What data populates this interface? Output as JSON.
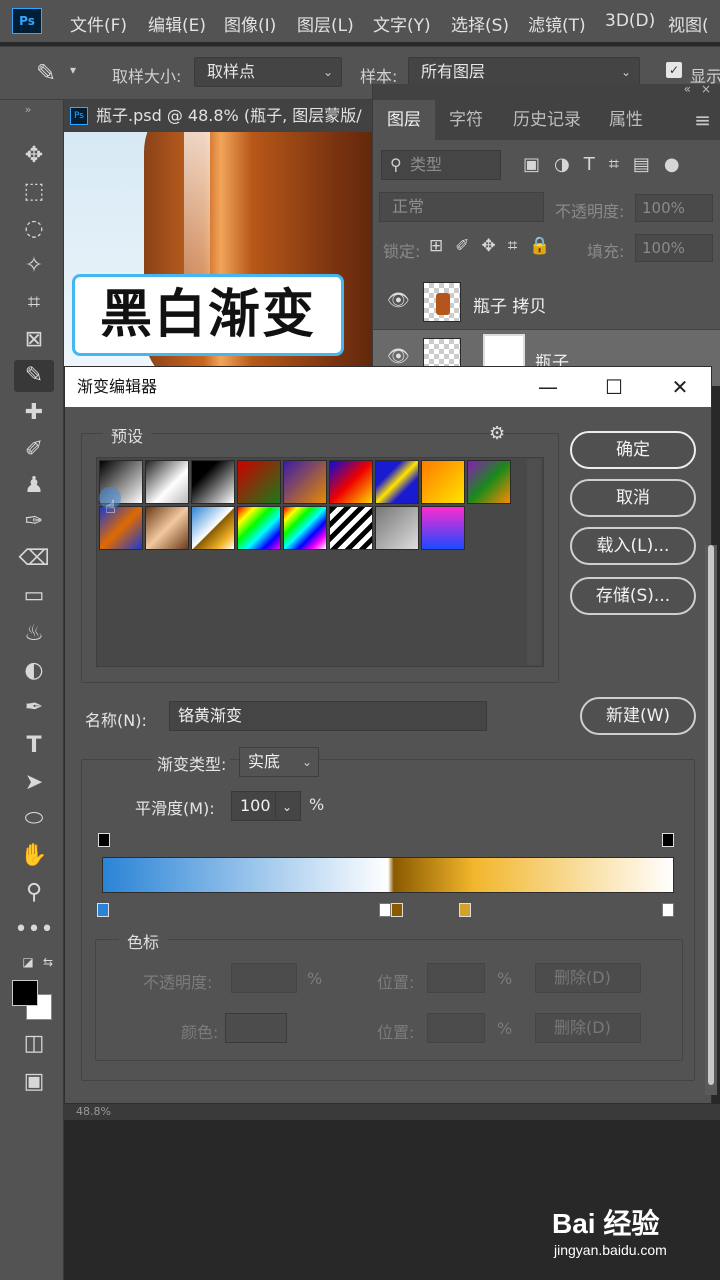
{
  "app": {
    "logo": "Ps",
    "menu": [
      "文件(F)",
      "编辑(E)",
      "图像(I)",
      "图层(L)",
      "文字(Y)",
      "选择(S)",
      "滤镜(T)",
      "3D(D)",
      "视图("
    ]
  },
  "options": {
    "sample_size_label": "取样大小:",
    "sample_size_value": "取样点",
    "sample_label": "样本:",
    "sample_value": "所有图层",
    "show_label": "显示"
  },
  "document": {
    "tab_title": "瓶子.psd @ 48.8% (瓶子, 图层蒙版/",
    "canvas_label": "黑白渐变",
    "status": "48.8%"
  },
  "layers_panel": {
    "tabs": [
      "图层",
      "字符",
      "历史记录",
      "属性"
    ],
    "filter_placeholder": "类型",
    "blend_mode": "正常",
    "opacity_label": "不透明度:",
    "opacity_value": "100%",
    "lock_label": "锁定:",
    "fill_label": "填充:",
    "fill_value": "100%",
    "layers": [
      {
        "name": "瓶子 拷贝"
      },
      {
        "name": "瓶子"
      }
    ]
  },
  "dialog": {
    "title": "渐变编辑器",
    "presets_label": "预设",
    "buttons": {
      "ok": "确定",
      "cancel": "取消",
      "load": "载入(L)...",
      "save": "存储(S)...",
      "new": "新建(W)"
    },
    "name_label": "名称(N):",
    "name_value": "铬黄渐变",
    "type_label": "渐变类型:",
    "type_value": "实底",
    "smooth_label": "平滑度(M):",
    "smooth_value": "100",
    "smooth_unit": "%",
    "stops_group_label": "色标",
    "stop_opacity_label": "不透明度:",
    "stop_opacity_unit": "%",
    "stop_position_label": "位置:",
    "stop_position_unit": "%",
    "stop_color_label": "颜色:",
    "delete_label": "删除(D)",
    "gradient_colors": [
      "#2a84d6",
      "#ffffff",
      "#8a5a00",
      "#f2b62c",
      "#ffffff"
    ]
  },
  "watermark": {
    "logo_text": "Bai 经验",
    "url": "jingyan.baidu.com"
  }
}
